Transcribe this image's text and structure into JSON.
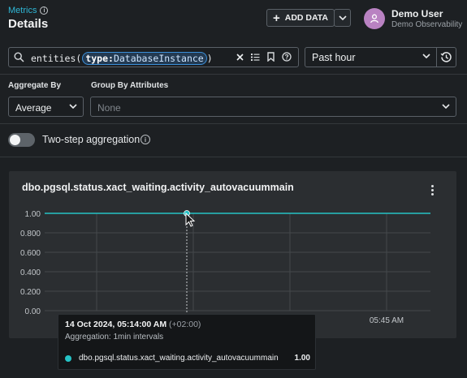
{
  "header": {
    "breadcrumb": "Metrics",
    "title": "Details",
    "add_data_label": "ADD DATA",
    "user_name": "Demo User",
    "user_org": "Demo Observability"
  },
  "query": {
    "prefix": "entities(",
    "key": "type:",
    "value": "DatabaseInstance",
    "suffix": ")"
  },
  "time_range": "Past hour",
  "aggregate": {
    "label": "Aggregate By",
    "value": "Average"
  },
  "group_by": {
    "label": "Group By Attributes",
    "placeholder": "None"
  },
  "two_step": {
    "label": "Two-step aggregation",
    "enabled": false
  },
  "chart_title": "dbo.pgsql.status.xact_waiting.activity_autovacuummain",
  "chart_data": {
    "type": "line",
    "y_ticks": [
      "1.00",
      "0.800",
      "0.600",
      "0.400",
      "0.200",
      "0.00"
    ],
    "x_ticks": [
      "05:45 AM"
    ],
    "ylim": [
      0,
      1
    ],
    "series": [
      {
        "name": "dbo.pgsql.status.xact_waiting.activity_autovacuummain",
        "color": "#25c3c6",
        "values": [
          1.0,
          1.0
        ]
      }
    ],
    "highlight_point": 1.0
  },
  "tooltip": {
    "time": "14 Oct 2024, 05:14:00 AM",
    "tz": "(+02:00)",
    "aggregation": "Aggregation: 1min intervals",
    "series_name": "dbo.pgsql.status.xact_waiting.activity_autovacuummain",
    "value": "1.00"
  }
}
